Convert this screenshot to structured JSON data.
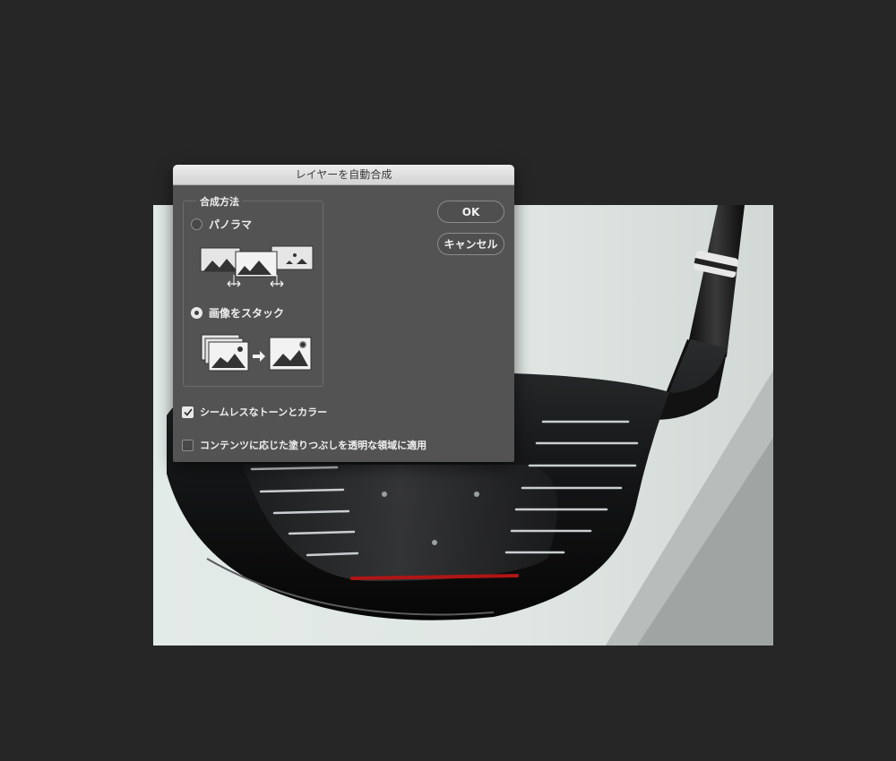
{
  "dialog": {
    "title": "レイヤーを自動合成",
    "blend_method": {
      "legend": "合成方法",
      "options": [
        {
          "label": "パノラマ",
          "selected": false
        },
        {
          "label": "画像をスタック",
          "selected": true
        }
      ]
    },
    "checkboxes": [
      {
        "label": "シームレスなトーンとカラー",
        "checked": true
      },
      {
        "label": "コンテンツに応じた塗りつぶしを透明な領域に適用",
        "checked": false
      }
    ],
    "buttons": {
      "ok": "OK",
      "cancel": "キャンセル"
    }
  },
  "canvas": {
    "background_color": "#dfe6e3",
    "accent_color": "#b01515"
  },
  "app_background": "#262626"
}
